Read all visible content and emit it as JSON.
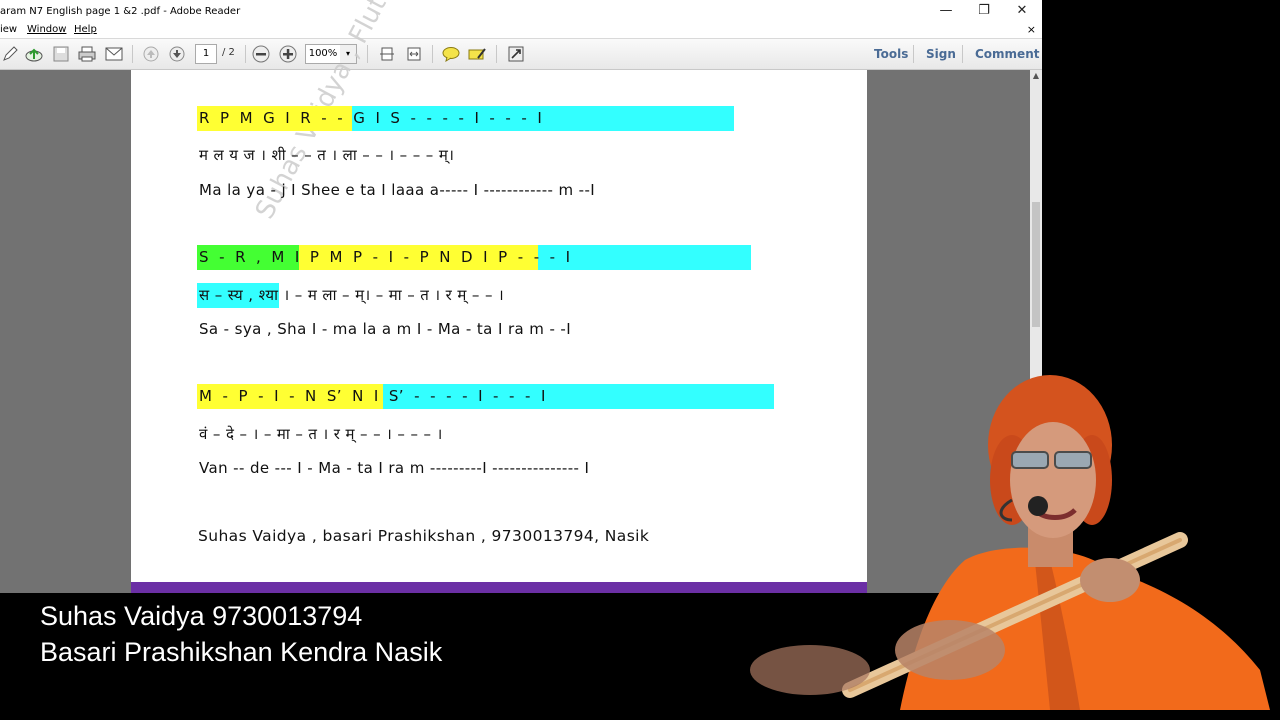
{
  "window": {
    "title": "aram N7 English page 1 &2 .pdf - Adobe Reader",
    "controls": {
      "minimize": "—",
      "restore": "❐",
      "close": "✕"
    }
  },
  "menu": {
    "items": [
      "iew",
      "Window",
      "Help"
    ],
    "close_doc": "×"
  },
  "toolbar": {
    "page_current": "1",
    "page_total": "/ 2",
    "zoom": "100%",
    "zoom_arrow": "▾",
    "right_links": [
      "Tools",
      "Sign",
      "Comment"
    ]
  },
  "document": {
    "watermark": "Suhas Vaidya , Flute",
    "blocks": [
      {
        "notation": "R   P   M   G I R  -   -  G  I  S  -  -  -   -  I  -   -    -    I",
        "devanagari": "म    ल    य   ज । शी   –    –   त । ला   –      –  ।  –   –    –   म्।",
        "roman": "Ma  la   ya   - j   I  Shee   e  ta   I  laaa    a-----  I  ------------  m  --I"
      },
      {
        "notation": "S   -   R  , M  I  P  M  P  -  I  -  P  N   D  I  P  -  -  -   I",
        "devanagari": "स  –  स्य  , श्या  ।   – म  ला – म्। –  मा  –   त   । र म्  – –   ।",
        "roman": "Sa   -  sya  , Sha   I    -  ma la a m I   -  Ma   -   ta   I  ra   m   -  -I"
      },
      {
        "notation": "M   -   P   -   I   -  N   S’  N   I  S’  -  -  -  -  I  -   -   -   I",
        "devanagari": "वं   –  दे –    ।  – मा   –   त    ।  र म्  –   –    ।    –   – – ।",
        "roman": "Van  --  de  ---  I   -  Ma  -  ta     I  ra   m  ---------I   ---------------  I"
      }
    ],
    "credit": "Suhas Vaidya , basari Prashikshan , 9730013794, Nasik"
  },
  "overlay": {
    "line1": "Suhas Vaidya 9730013794",
    "line2": "Basari Prashikshan Kendra Nasik"
  },
  "colors": {
    "yellow": "#ffff33",
    "cyan": "#33ffff",
    "green": "#44ff33",
    "footer_band": "#6b2fa5",
    "link": "#4a6b95",
    "shirt": "#f26a1b"
  },
  "icons": [
    "edit-icon",
    "upload-icon",
    "save-icon",
    "print-icon",
    "mail-icon",
    "page-up-icon",
    "page-down-icon",
    "zoom-out-icon",
    "zoom-in-icon",
    "fit-page-icon",
    "fit-width-icon",
    "comment-icon",
    "highlight-icon",
    "fullscreen-icon"
  ]
}
